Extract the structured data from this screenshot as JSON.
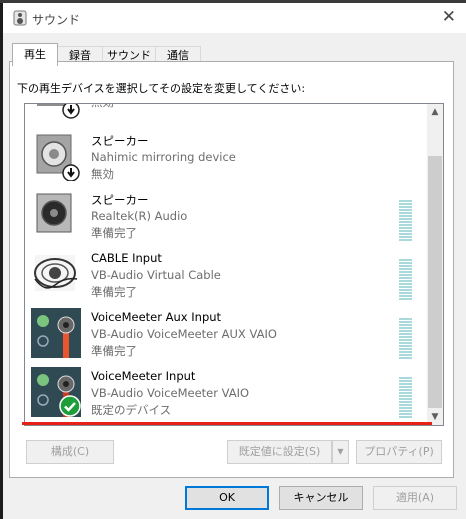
{
  "window": {
    "title": "サウンド",
    "close_glyph": "✕"
  },
  "tabs": [
    {
      "label": "再生"
    },
    {
      "label": "録音"
    },
    {
      "label": "サウンド"
    },
    {
      "label": "通信"
    }
  ],
  "instructions": "下の再生デバイスを選択してその設定を変更してください:",
  "devices": [
    {
      "name": "",
      "description": "",
      "status": "無効",
      "icon": "speaker-disabled-icon"
    },
    {
      "name": "スピーカー",
      "description": "Nahimic mirroring device",
      "status": "無効",
      "icon": "speaker-disabled-icon"
    },
    {
      "name": "スピーカー",
      "description": "Realtek(R) Audio",
      "status": "準備完了",
      "icon": "speaker-icon"
    },
    {
      "name": "CABLE Input",
      "description": "VB-Audio Virtual Cable",
      "status": "準備完了",
      "icon": "cable-icon"
    },
    {
      "name": "VoiceMeeter Aux Input",
      "description": "VB-Audio VoiceMeeter AUX VAIO",
      "status": "準備完了",
      "icon": "voicemeeter-icon"
    },
    {
      "name": "VoiceMeeter Input",
      "description": "VB-Audio VoiceMeeter VAIO",
      "status": "既定のデバイス",
      "icon": "voicemeeter-default-icon"
    }
  ],
  "buttons": {
    "configure": "構成(C)",
    "set_default": "既定値に設定(S)",
    "properties": "プロパティ(P)",
    "ok": "OK",
    "cancel": "キャンセル",
    "apply": "適用(A)"
  },
  "colors": {
    "annotation_red": "#e8201a",
    "default_check": "#1e9e3a",
    "meter": "#a8dadc",
    "voicemeeter_bg": "#2f4a52"
  }
}
